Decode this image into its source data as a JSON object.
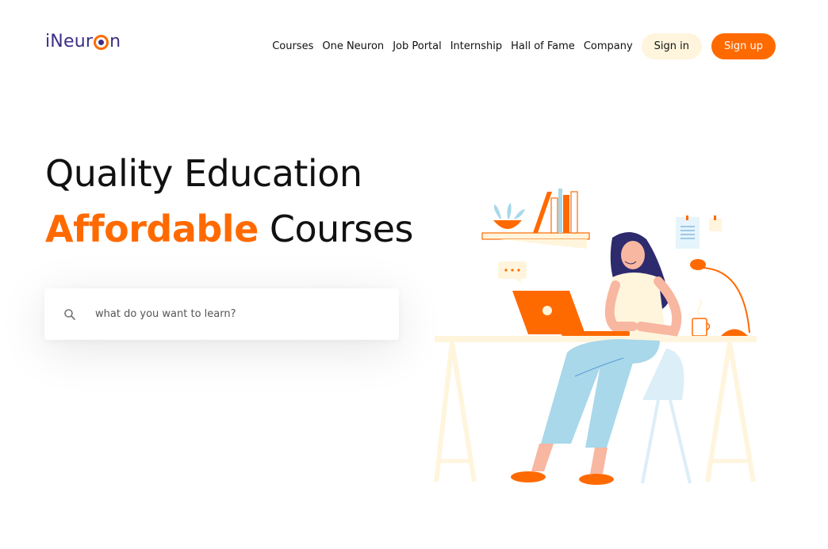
{
  "brand": {
    "logo_pre": "iNeur",
    "logo_post": "n"
  },
  "nav": {
    "links": [
      "Courses",
      "One Neuron",
      "Job Portal",
      "Internship",
      "Hall of Fame",
      "Company"
    ],
    "signin_label": "Sign in",
    "signup_label": "Sign up"
  },
  "hero": {
    "line1": "Quality Education",
    "line2_accent": "Affordable",
    "line2_rest": " Courses"
  },
  "search": {
    "placeholder": "what do you want to learn?",
    "value": ""
  },
  "colors": {
    "accent": "#ff6a00",
    "brand": "#3b2f86",
    "signin_bg": "#fff5dd"
  },
  "icons": {
    "search": "search-icon",
    "logo_o": "eye-ring-icon"
  }
}
